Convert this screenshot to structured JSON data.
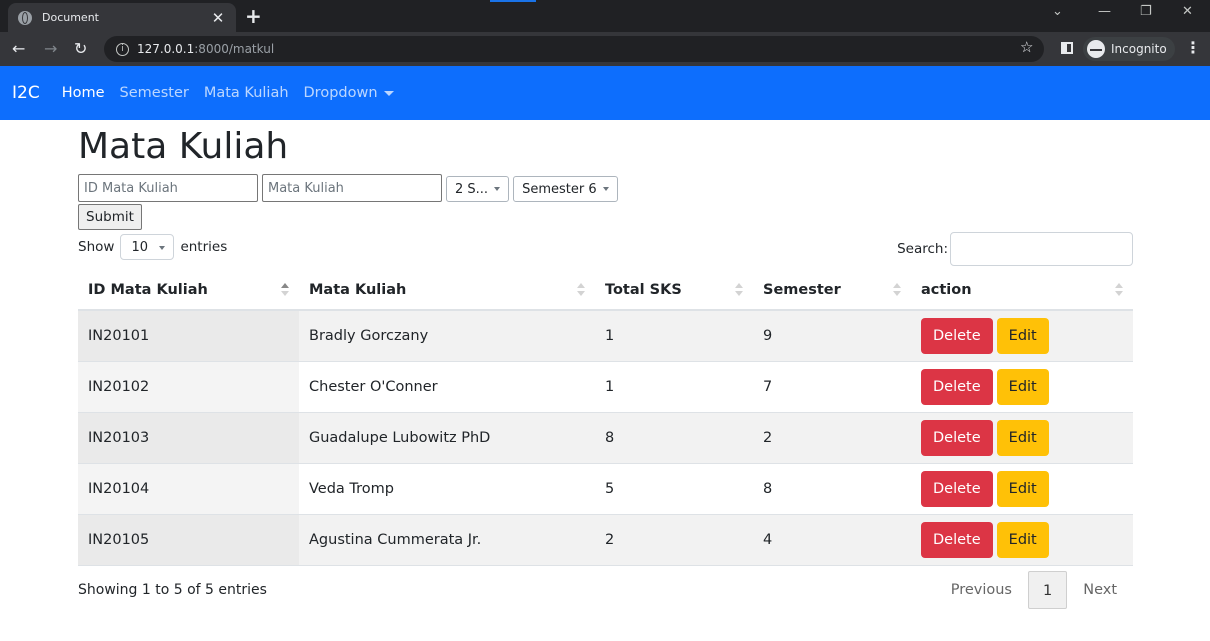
{
  "browser": {
    "tab_title": "Document",
    "tab_close": "✕",
    "new_tab": "+",
    "url_host": "127.0.0.1",
    "url_path": ":8000/matkul",
    "incognito_label": "Incognito"
  },
  "navbar": {
    "brand": "I2C",
    "links": [
      "Home",
      "Semester",
      "Mata Kuliah",
      "Dropdown"
    ]
  },
  "page": {
    "title": "Mata Kuliah"
  },
  "form": {
    "id_placeholder": "ID Mata Kuliah",
    "name_placeholder": "Mata Kuliah",
    "sks_selected": "2 S...",
    "semester_selected": "Semester 6",
    "submit_label": "Submit"
  },
  "datatable": {
    "show_label": "Show",
    "length_value": "10",
    "entries_label": "entries",
    "search_label": "Search:",
    "columns": [
      "ID Mata Kuliah",
      "Mata Kuliah",
      "Total SKS",
      "Semester",
      "action"
    ],
    "rows": [
      [
        "IN20101",
        "Bradly Gorczany",
        "1",
        "9"
      ],
      [
        "IN20102",
        "Chester O'Conner",
        "1",
        "7"
      ],
      [
        "IN20103",
        "Guadalupe Lubowitz PhD",
        "8",
        "2"
      ],
      [
        "IN20104",
        "Veda Tromp",
        "5",
        "8"
      ],
      [
        "IN20105",
        "Agustina Cummerata Jr.",
        "2",
        "4"
      ]
    ],
    "delete_label": "Delete",
    "edit_label": "Edit",
    "info": "Showing 1 to 5 of 5 entries",
    "pagination": {
      "previous": "Previous",
      "current": "1",
      "next": "Next"
    }
  },
  "colors": {
    "navbar": "#0d6efd",
    "danger": "#dc3545",
    "warning": "#ffc107"
  }
}
